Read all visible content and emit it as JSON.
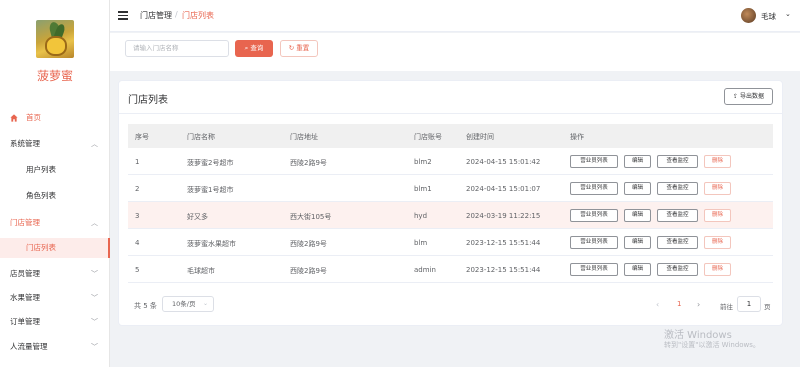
{
  "brand": {
    "name": "菠萝蜜"
  },
  "sidebar": {
    "items": [
      {
        "label": "首页",
        "icon": "home-icon"
      },
      {
        "label": "系统管理"
      },
      {
        "label": "用户列表"
      },
      {
        "label": "角色列表"
      },
      {
        "label": "门店管理"
      },
      {
        "label": "门店列表"
      },
      {
        "label": "店员管理"
      },
      {
        "label": "水果管理"
      },
      {
        "label": "订单管理"
      },
      {
        "label": "人流量管理"
      }
    ]
  },
  "header": {
    "breadcrumb": [
      "门店管理",
      "门店列表"
    ],
    "separator": "/",
    "user_name": "毛球"
  },
  "search": {
    "placeholder": "请输入门店名称",
    "search_label": "查询",
    "reset_label": "重置"
  },
  "card": {
    "title": "门店列表",
    "export_label": "导出数据"
  },
  "table": {
    "headers": [
      "序号",
      "门店名称",
      "门店地址",
      "门店账号",
      "创建时间",
      "操作"
    ],
    "rows": [
      {
        "no": "1",
        "name": "菠萝蜜2号超市",
        "address": "西陵2路9号",
        "account": "blm2",
        "created": "2024-04-15 15:01:42"
      },
      {
        "no": "2",
        "name": "菠萝蜜1号超市",
        "address": "",
        "account": "blm1",
        "created": "2024-04-15 15:01:07"
      },
      {
        "no": "3",
        "name": "好又多",
        "address": "西大街105号",
        "account": "hyd",
        "created": "2024-03-19 11:22:15"
      },
      {
        "no": "4",
        "name": "菠萝蜜水果超市",
        "address": "西陵2路9号",
        "account": "blm",
        "created": "2023-12-15 15:51:44"
      },
      {
        "no": "5",
        "name": "毛球超市",
        "address": "西陵2路9号",
        "account": "admin",
        "created": "2023-12-15 15:51:44"
      }
    ],
    "actions": {
      "staff": "营业员列表",
      "edit": "编辑",
      "monitor": "查看监控",
      "delete": "删除"
    }
  },
  "pagination": {
    "total_text": "共 5 条",
    "page_size": "10条/页",
    "current_page": "1",
    "goto_label": "前往",
    "goto_value": "1",
    "goto_suffix": "页"
  },
  "watermark": {
    "line1": "激活 Windows",
    "line2": "转到\"设置\"以激活 Windows。"
  },
  "colors": {
    "accent": "#e8654f",
    "highlight_row": "#fdf1ef"
  }
}
